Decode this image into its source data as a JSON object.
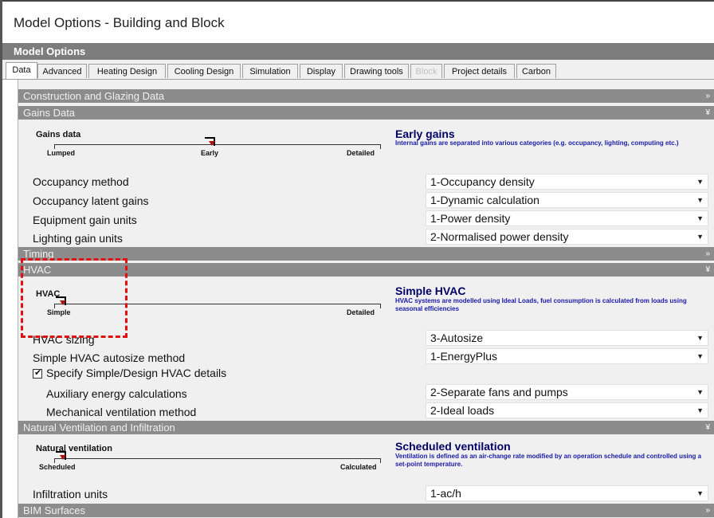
{
  "window": {
    "title": "Model Options - Building and Block"
  },
  "header": {
    "title": "Model Options"
  },
  "tabs": [
    {
      "label": "Data",
      "state": "active"
    },
    {
      "label": "Advanced",
      "state": "normal"
    },
    {
      "label": "Heating Design",
      "state": "normal"
    },
    {
      "label": "Cooling Design",
      "state": "normal"
    },
    {
      "label": "Simulation",
      "state": "normal"
    },
    {
      "label": "Display",
      "state": "normal"
    },
    {
      "label": "Drawing tools",
      "state": "normal"
    },
    {
      "label": "Block",
      "state": "disabled"
    },
    {
      "label": "Project details",
      "state": "normal"
    },
    {
      "label": "Carbon",
      "state": "normal"
    }
  ],
  "sections": {
    "construction": {
      "title": "Construction and Glazing Data",
      "icon": "expand-chevron-icon",
      "glyph": "»"
    },
    "gains": {
      "title": "Gains Data",
      "icon": "collapse-chevron-icon",
      "glyph": "¥"
    },
    "timing": {
      "title": "Timing",
      "icon": "expand-chevron-icon",
      "glyph": "»"
    },
    "hvac": {
      "title": "HVAC",
      "icon": "collapse-chevron-icon",
      "glyph": "¥"
    },
    "ventilation": {
      "title": "Natural Ventilation and Infiltration",
      "icon": "collapse-chevron-icon",
      "glyph": "¥"
    },
    "bim": {
      "title": "BIM Surfaces",
      "icon": "expand-chevron-icon",
      "glyph": "»"
    }
  },
  "gains": {
    "slider": {
      "label": "Gains data",
      "left": "Lumped",
      "mid": "Early",
      "right": "Detailed",
      "position": 0.5
    },
    "desc_title": "Early gains",
    "desc_text": "Internal gains are separated into various categories (e.g. occupancy, lighting, computing etc.)",
    "rows": [
      {
        "label": "Occupancy method",
        "value": "1-Occupancy density"
      },
      {
        "label": "Occupancy latent gains",
        "value": "1-Dynamic calculation"
      },
      {
        "label": "Equipment gain units",
        "value": "1-Power density"
      },
      {
        "label": "Lighting gain units",
        "value": "2-Normalised power density"
      }
    ]
  },
  "hvac": {
    "slider": {
      "label": "HVAC",
      "left": "Simple",
      "right": "Detailed",
      "position": 0.0
    },
    "desc_title": "Simple HVAC",
    "desc_text": "HVAC systems are modelled using Ideal Loads, fuel consumption is calculated from loads using seasonal efficiencies",
    "rows": [
      {
        "label": "HVAC sizing",
        "value": "3-Autosize"
      },
      {
        "label": "Simple HVAC autosize method",
        "value": "1-EnergyPlus"
      }
    ],
    "checkbox_label": "Specify Simple/Design HVAC details",
    "checkbox_checked": true,
    "sub_rows": [
      {
        "label": "Auxiliary energy calculations",
        "value": "2-Separate fans and pumps"
      },
      {
        "label": "Mechanical ventilation method",
        "value": "2-Ideal loads"
      }
    ]
  },
  "ventilation": {
    "slider": {
      "label": "Natural ventilation",
      "left": "Scheduled",
      "right": "Calculated",
      "position": 0.0
    },
    "desc_title": "Scheduled ventilation",
    "desc_text": "Ventilation is defined as an air-change rate modified by an operation schedule and controlled using a set-point temperature.",
    "rows": [
      {
        "label": "Infiltration units",
        "value": "1-ac/h"
      }
    ]
  },
  "dropdown_arrow_icon": "dropdown-arrow-icon",
  "colors": {
    "section_bar": "#8c8c8c",
    "header": "#7d7d7d",
    "desc_title": "#000066",
    "desc_text": "#1a1aa8",
    "highlight": "#e01010"
  }
}
